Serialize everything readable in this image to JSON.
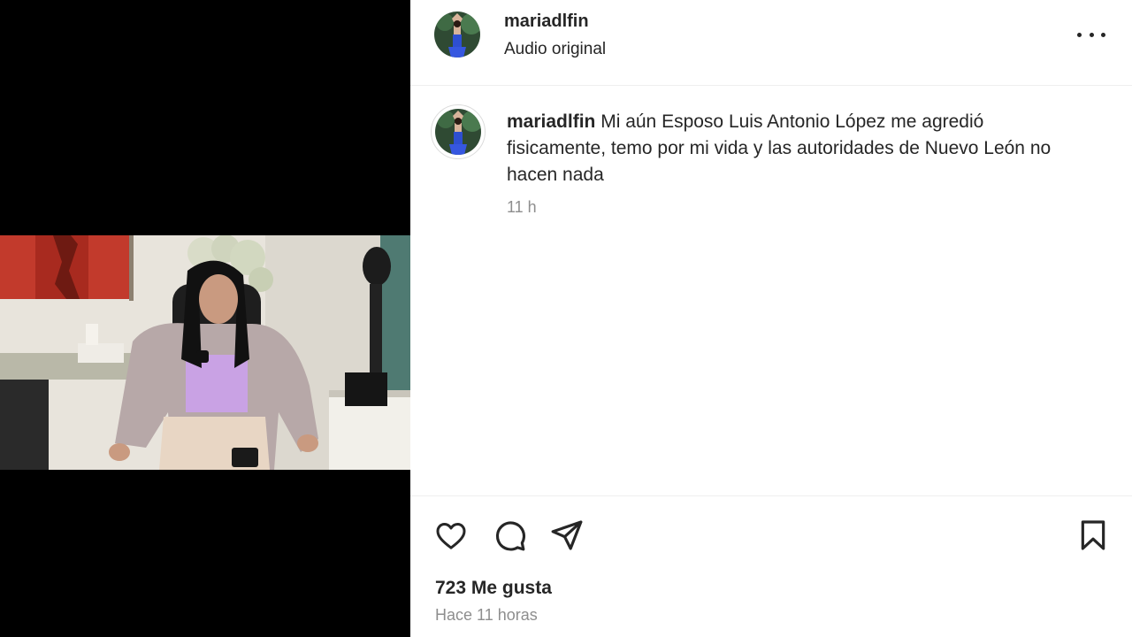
{
  "post": {
    "username": "mariadlfin",
    "audio": "Audio original",
    "caption_username": "mariadlfin",
    "caption_text": "Mi aún Esposo Luis Antonio López me agredió fisicamente, temo por mi vida y las autoridades de Nuevo León no hacen nada",
    "caption_time": "11 h",
    "likes": "723 Me gusta",
    "posted_time": "Hace 11 horas"
  },
  "icons": {
    "more": "more-options-icon",
    "like": "heart-icon",
    "comment": "comment-icon",
    "share": "send-icon",
    "save": "bookmark-icon"
  },
  "colors": {
    "text": "#262626",
    "secondary_text": "#8e8e8e",
    "divider": "#efefef",
    "media_background": "#000000"
  }
}
